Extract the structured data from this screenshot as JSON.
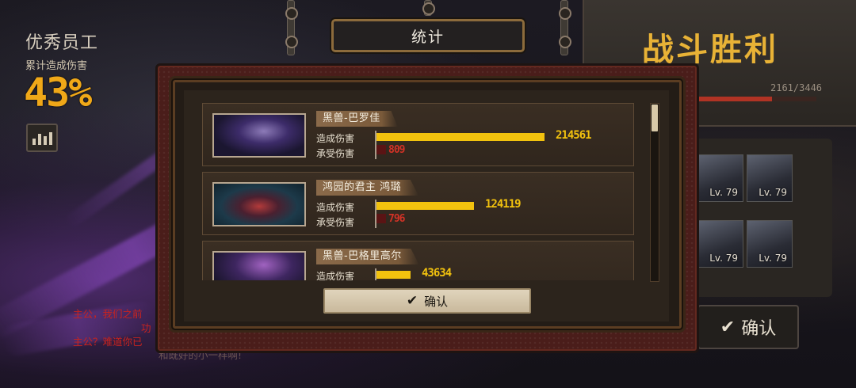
{
  "left_hud": {
    "title": "优秀员工",
    "subtitle": "累计造成伤害",
    "percent": "43%",
    "dialog": [
      "主公，我们之前",
      "功",
      "主公？难道你已",
      "和既好的小一样啊!"
    ]
  },
  "right_hud": {
    "result": "战斗胜利",
    "exp_text": "2161/3446",
    "exp_value": 2161,
    "exp_max": 3446,
    "levels": [
      "Lv. 79",
      "Lv. 79",
      "Lv. 79",
      "Lv. 79"
    ],
    "confirm_label": "确认"
  },
  "modal": {
    "title": "统计",
    "confirm_label": "确认",
    "damage_dealt_label": "造成伤害",
    "damage_taken_label": "承受伤害",
    "rows": [
      {
        "name": "黑兽-巴罗佳",
        "dealt": "214561",
        "taken": "809"
      },
      {
        "name": "鸿园的君主 鸿璐",
        "dealt": "124119",
        "taken": "796"
      },
      {
        "name": "黑兽-巴格里高尔",
        "dealt": "43634",
        "taken": ""
      }
    ]
  },
  "chart_data": {
    "type": "bar",
    "categories": [
      "黑兽-巴罗佳",
      "鸿园的君主 鸿璐",
      "黑兽-巴格里高尔"
    ],
    "series": [
      {
        "name": "造成伤害",
        "values": [
          214561,
          124119,
          43634
        ]
      },
      {
        "name": "承受伤害",
        "values": [
          809,
          796,
          null
        ]
      }
    ]
  },
  "colors": {
    "accent_gold": "#f2c20e",
    "taken_red": "#d23226",
    "modal_border": "#4a1d1a"
  }
}
